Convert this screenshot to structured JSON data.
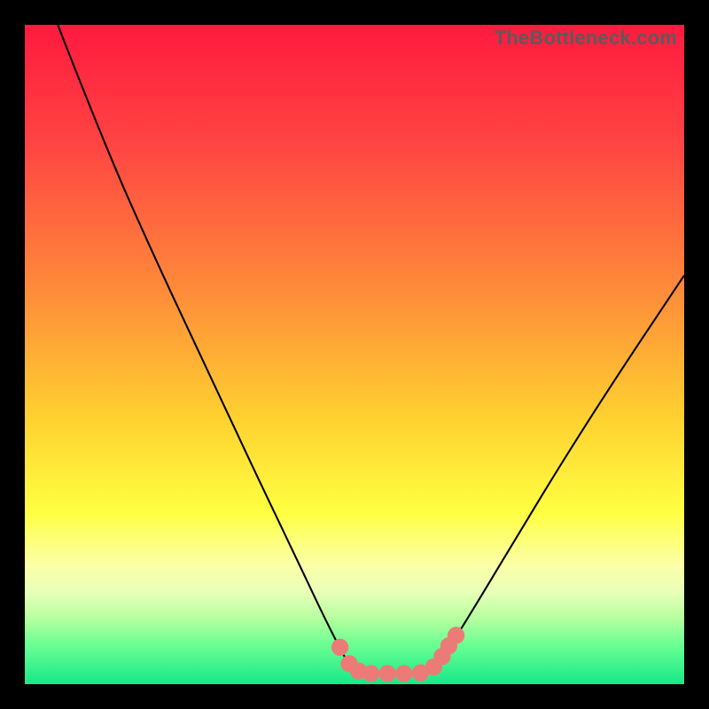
{
  "watermark": "TheBottleneck.com",
  "chart_data": {
    "type": "line",
    "title": "",
    "xlabel": "",
    "ylabel": "",
    "xlim": [
      0,
      100
    ],
    "ylim": [
      0,
      100
    ],
    "background_gradient_stops": [
      {
        "offset": 0,
        "color": "#ff1a3f"
      },
      {
        "offset": 18,
        "color": "#ff4443"
      },
      {
        "offset": 40,
        "color": "#ff8a3a"
      },
      {
        "offset": 60,
        "color": "#ffd230"
      },
      {
        "offset": 74,
        "color": "#ffff42"
      },
      {
        "offset": 82,
        "color": "#fbffa8"
      },
      {
        "offset": 86,
        "color": "#e8ffb8"
      },
      {
        "offset": 90,
        "color": "#b6ff9f"
      },
      {
        "offset": 94,
        "color": "#6bff93"
      },
      {
        "offset": 100,
        "color": "#17e889"
      }
    ],
    "series": [
      {
        "name": "bottleneck-curve",
        "color": "#000000",
        "points": [
          {
            "x": 5.0,
            "y": 100.0
          },
          {
            "x": 12.0,
            "y": 82.0
          },
          {
            "x": 20.0,
            "y": 64.0
          },
          {
            "x": 28.0,
            "y": 47.0
          },
          {
            "x": 35.0,
            "y": 32.0
          },
          {
            "x": 41.0,
            "y": 19.5
          },
          {
            "x": 45.0,
            "y": 11.0
          },
          {
            "x": 47.5,
            "y": 6.0
          },
          {
            "x": 49.0,
            "y": 3.2
          },
          {
            "x": 50.5,
            "y": 2.0
          },
          {
            "x": 53.0,
            "y": 1.6
          },
          {
            "x": 56.0,
            "y": 1.6
          },
          {
            "x": 59.0,
            "y": 1.6
          },
          {
            "x": 61.5,
            "y": 2.2
          },
          {
            "x": 63.0,
            "y": 3.5
          },
          {
            "x": 65.0,
            "y": 6.5
          },
          {
            "x": 69.0,
            "y": 13.0
          },
          {
            "x": 75.0,
            "y": 23.0
          },
          {
            "x": 82.0,
            "y": 34.5
          },
          {
            "x": 90.0,
            "y": 47.0
          },
          {
            "x": 100.0,
            "y": 62.0
          }
        ]
      }
    ],
    "markers": {
      "name": "highlight-points",
      "color": "#ec7b78",
      "radius": 1.3,
      "points": [
        {
          "x": 47.8,
          "y": 5.6
        },
        {
          "x": 49.2,
          "y": 3.1
        },
        {
          "x": 50.6,
          "y": 2.0
        },
        {
          "x": 52.5,
          "y": 1.6
        },
        {
          "x": 55.0,
          "y": 1.6
        },
        {
          "x": 57.5,
          "y": 1.6
        },
        {
          "x": 60.0,
          "y": 1.7
        },
        {
          "x": 62.0,
          "y": 2.6
        },
        {
          "x": 63.3,
          "y": 4.2
        },
        {
          "x": 64.3,
          "y": 5.8
        },
        {
          "x": 65.4,
          "y": 7.4
        }
      ]
    }
  }
}
